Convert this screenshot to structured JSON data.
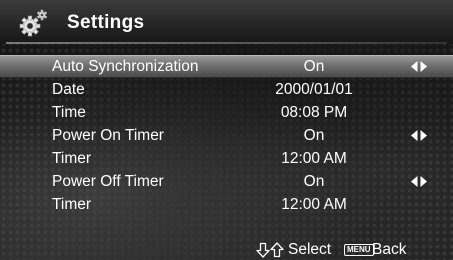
{
  "header": {
    "title": "Settings",
    "icon": "gear-icon"
  },
  "settings": {
    "items": [
      {
        "label": "Auto Synchronization",
        "value": "On",
        "selected": true,
        "adjustable": true
      },
      {
        "label": "Date",
        "value": "2000/01/01",
        "selected": false,
        "adjustable": false
      },
      {
        "label": "Time",
        "value": "08:08 PM",
        "selected": false,
        "adjustable": false
      },
      {
        "label": "Power On Timer",
        "value": "On",
        "selected": false,
        "adjustable": true
      },
      {
        "label": "Timer",
        "value": "12:00 AM",
        "selected": false,
        "adjustable": false
      },
      {
        "label": "Power Off Timer",
        "value": "On",
        "selected": false,
        "adjustable": true
      },
      {
        "label": "Timer",
        "value": "12:00 AM",
        "selected": false,
        "adjustable": false
      }
    ]
  },
  "footer": {
    "select_label": "Select",
    "menu_key_label": "MENU",
    "back_label": "Back"
  },
  "colors": {
    "text": "#ffffff",
    "selection_bar": "#7a7a7a",
    "background": "#141414"
  }
}
